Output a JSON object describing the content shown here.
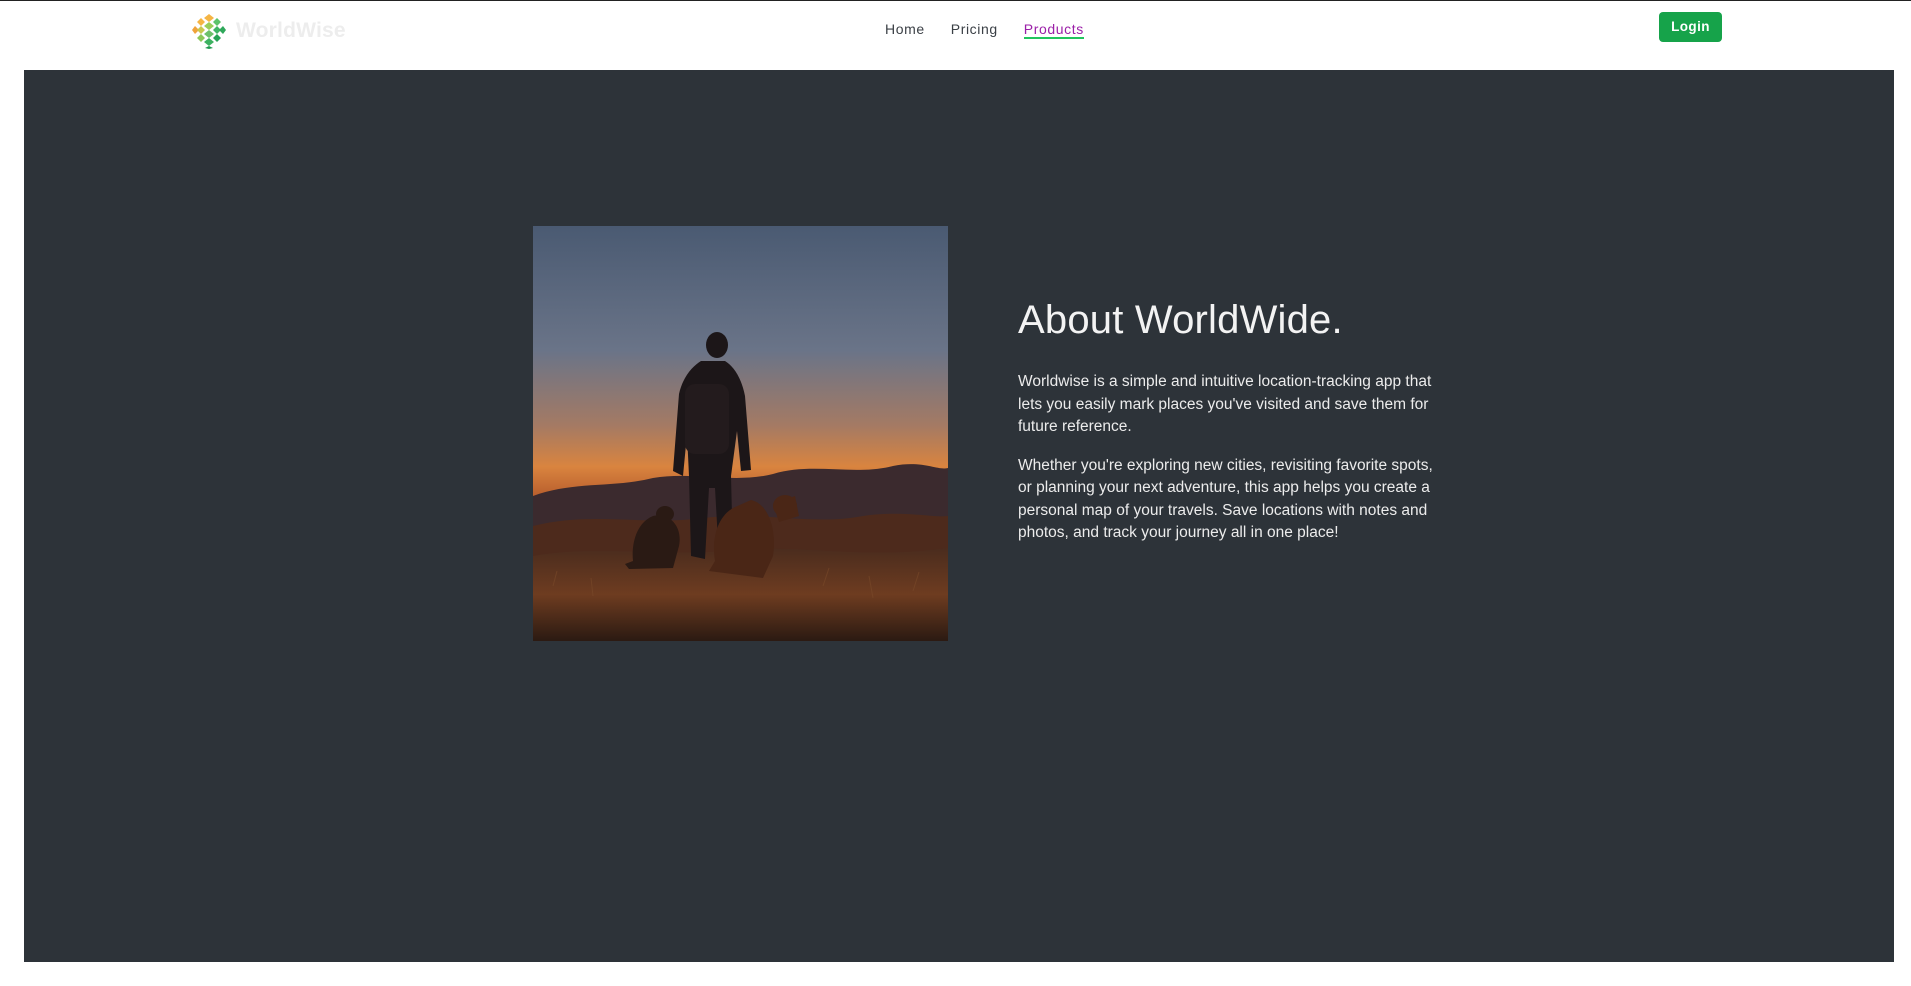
{
  "brand": {
    "name": "WorldWise",
    "logo_icon": "globe-hex-icon",
    "colors": {
      "accent_green": "#16a34a",
      "panel_bg": "#2d3339",
      "active_link": "#9b1fa8"
    }
  },
  "nav": {
    "links": [
      {
        "label": "Home",
        "active": false
      },
      {
        "label": "Pricing",
        "active": false
      },
      {
        "label": "Products",
        "active": true
      }
    ],
    "login_label": "Login"
  },
  "about": {
    "title": "About WorldWide.",
    "paragraphs": [
      "Worldwise is a simple and intuitive location-tracking app that lets you easily mark places you've visited and save them for future reference.",
      "Whether you're exploring new cities, revisiting favorite spots, or planning your next adventure, this app helps you create a personal map of your travels. Save locations with notes and photos, and track your journey all in one place!"
    ]
  },
  "image": {
    "subject": "silhouette of hiker with dogs at sunset on mountain"
  }
}
